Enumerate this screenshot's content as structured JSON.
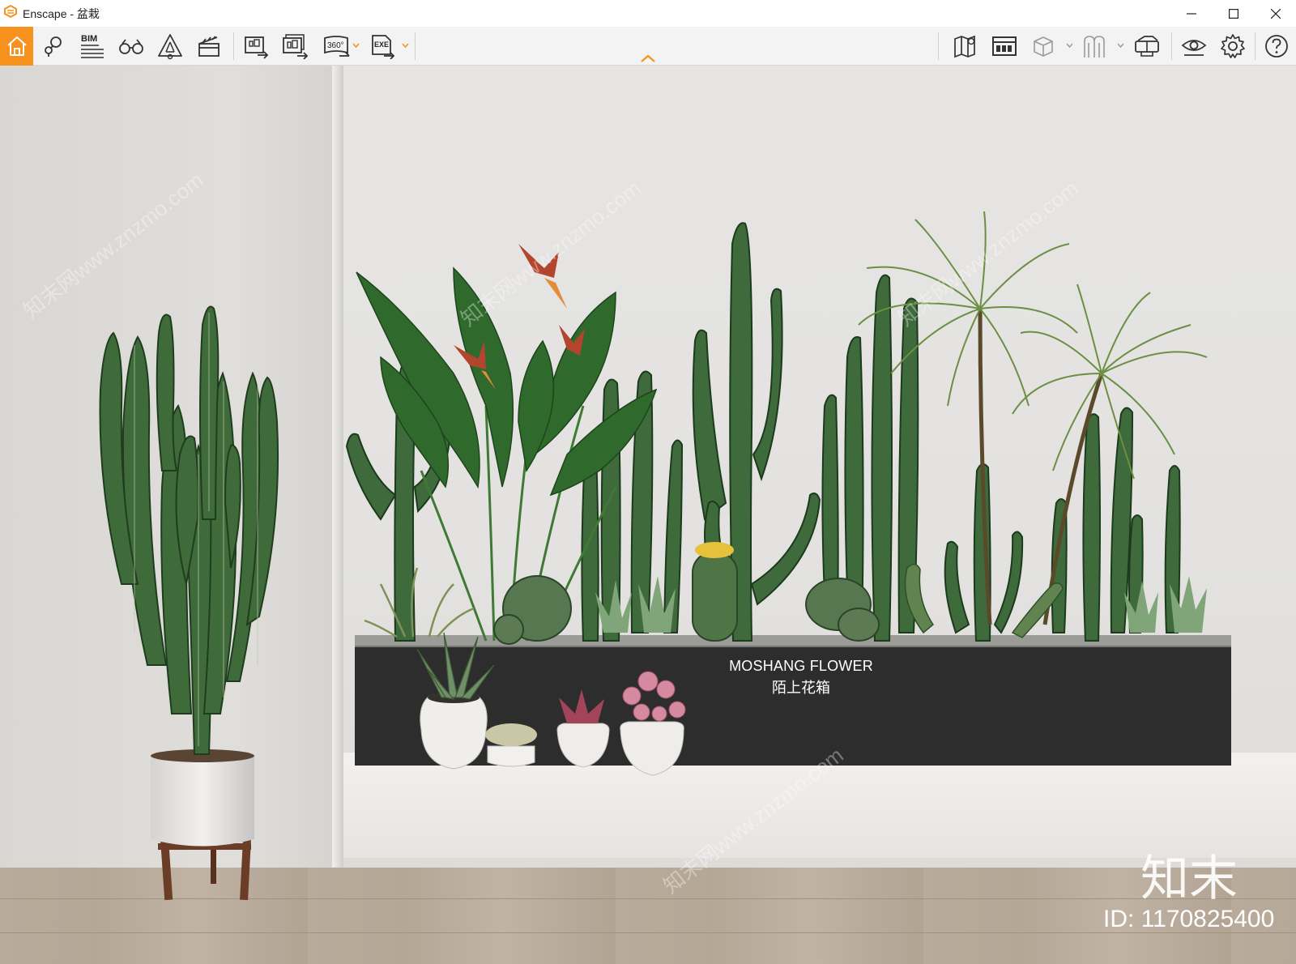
{
  "window": {
    "title": "Enscape - 盆栽",
    "controls": [
      "minimize-icon",
      "maximize-icon",
      "close-icon"
    ]
  },
  "toolbar": {
    "left_icons": [
      "home-icon",
      "location-pin-icon",
      "bim-icon",
      "binoculars-icon",
      "triangle-warning-icon",
      "clapperboard-icon",
      "render-screenshot-icon",
      "batch-render-icon",
      "panorama-360-icon",
      "exe-export-icon"
    ],
    "bim_label": "BIM",
    "panorama_label": "360°",
    "exe_label": "EXE",
    "right_icons": [
      "map-icon",
      "asset-library-icon",
      "cube-view-icon",
      "section-view-icon",
      "vr-headset-icon",
      "visual-settings-icon",
      "gear-icon",
      "help-icon"
    ],
    "accent_color": "#f7921e"
  },
  "viewport": {
    "planter_brand_en": "MOSHANG FLOWER",
    "planter_brand_cn": "陌上花箱",
    "watermark_logo": "知末",
    "watermark_id": "ID: 1170825400",
    "watermark_diagonal": "知末网www.znzmo.com"
  }
}
